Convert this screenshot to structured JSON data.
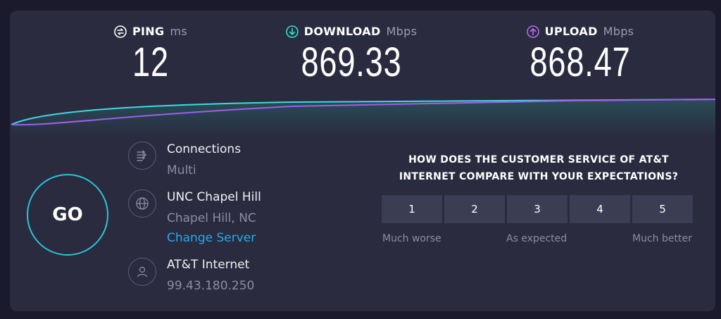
{
  "ping": {
    "label": "PING",
    "unit": "ms",
    "value": "12",
    "icon": "ping-icon"
  },
  "download": {
    "label": "DOWNLOAD",
    "unit": "Mbps",
    "value": "869.33",
    "icon": "download-arrow-icon",
    "color": "#2ee5c8"
  },
  "upload": {
    "label": "UPLOAD",
    "unit": "Mbps",
    "value": "868.47",
    "icon": "upload-arrow-icon",
    "color": "#b56cf0"
  },
  "go_button": {
    "label": "GO",
    "color": "#27c7d6"
  },
  "connections": {
    "title": "Connections",
    "value": "Multi",
    "icon": "connections-icon"
  },
  "server": {
    "name": "UNC Chapel Hill",
    "location": "Chapel Hill, NC",
    "change_label": "Change Server",
    "icon": "globe-icon"
  },
  "provider": {
    "name": "AT&T Internet",
    "ip": "99.43.180.250",
    "icon": "user-icon"
  },
  "survey": {
    "question_line1": "HOW DOES THE CUSTOMER SERVICE OF AT&T",
    "question_line2": "INTERNET COMPARE WITH YOUR EXPECTATIONS?",
    "ratings": [
      "1",
      "2",
      "3",
      "4",
      "5"
    ],
    "label_low": "Much worse",
    "label_mid": "As expected",
    "label_high": "Much better"
  }
}
